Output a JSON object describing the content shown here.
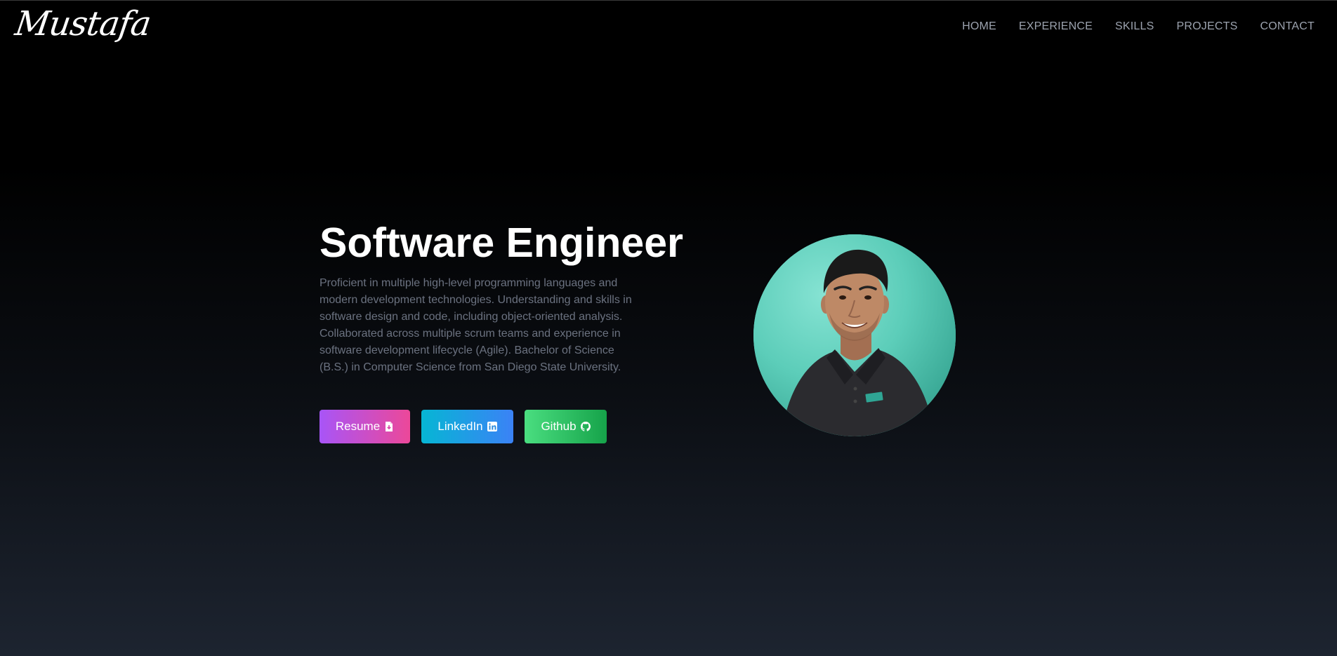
{
  "brand": {
    "logo_text": "Mustafa"
  },
  "nav": {
    "items": [
      {
        "label": "HOME"
      },
      {
        "label": "EXPERIENCE"
      },
      {
        "label": "SKILLS"
      },
      {
        "label": "PROJECTS"
      },
      {
        "label": "CONTACT"
      }
    ]
  },
  "hero": {
    "title": "Software Engineer",
    "description": "Proficient in multiple high-level programming languages and modern development technologies. Understanding and skills in software design and code, including object-oriented analysis. Collaborated across multiple scrum teams and experience in software development lifecycle (Agile). Bachelor of Science (B.S.) in Computer Science from San Diego State University.",
    "buttons": [
      {
        "label": "Resume",
        "icon": "file-download-icon",
        "color_from": "#a855f7",
        "color_to": "#ec4899"
      },
      {
        "label": "LinkedIn",
        "icon": "linkedin-icon",
        "color_from": "#06b6d4",
        "color_to": "#3b82f6"
      },
      {
        "label": "Github",
        "icon": "github-icon",
        "color_from": "#4ade80",
        "color_to": "#16a34a"
      }
    ]
  },
  "colors": {
    "background_top": "#000000",
    "background_bottom": "#1d2430",
    "nav_text": "#9ca3af",
    "description_text": "#6b7280",
    "avatar_bg": "#5ecfbb"
  }
}
